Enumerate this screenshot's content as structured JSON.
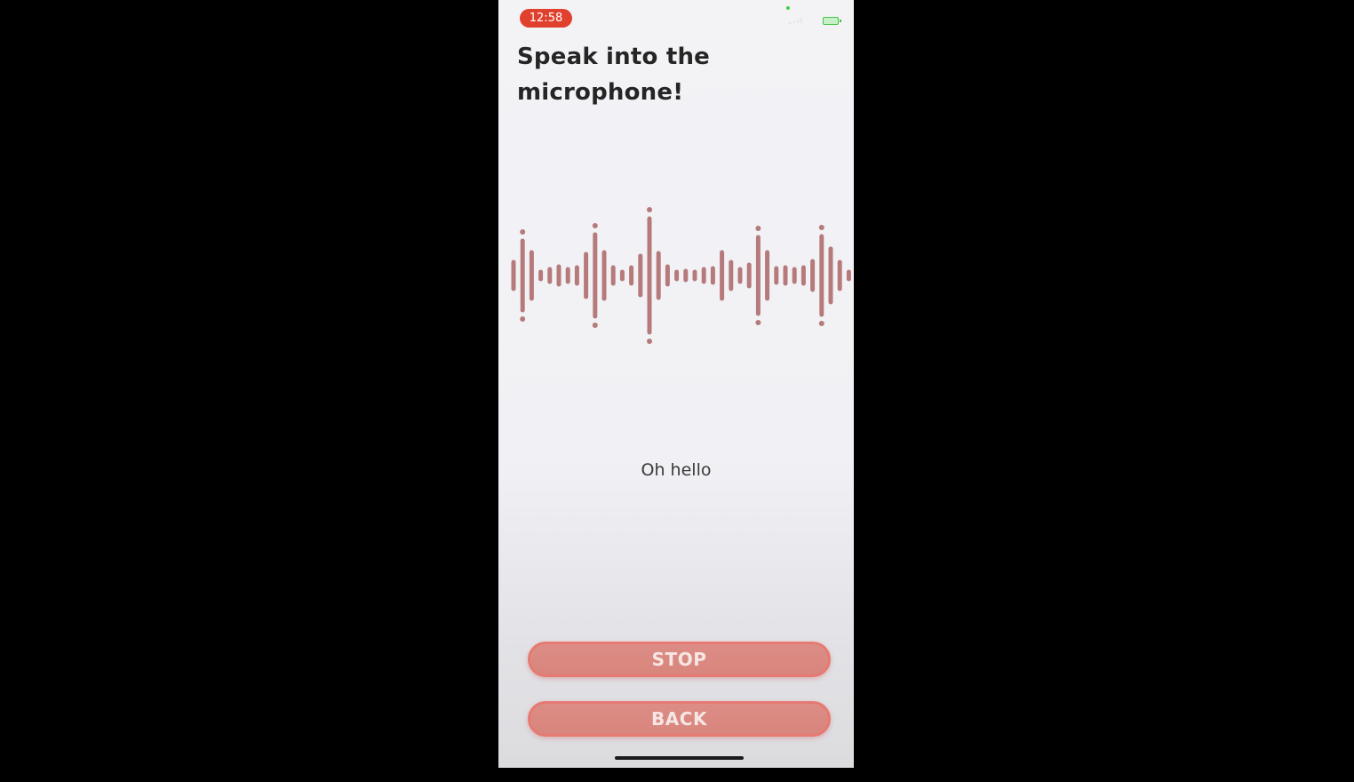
{
  "status_bar": {
    "time": "12:58",
    "icons": [
      "signal-icon",
      "wifi-icon",
      "battery-icon"
    ]
  },
  "screen": {
    "title": "Speak into the microphone!",
    "transcript": "Oh hello"
  },
  "buttons": {
    "stop_label": "STOP",
    "back_label": "BACK"
  },
  "colors": {
    "accent": "#d8857d",
    "waveform": "#b67a7b",
    "time_pill": "#e0412e"
  }
}
